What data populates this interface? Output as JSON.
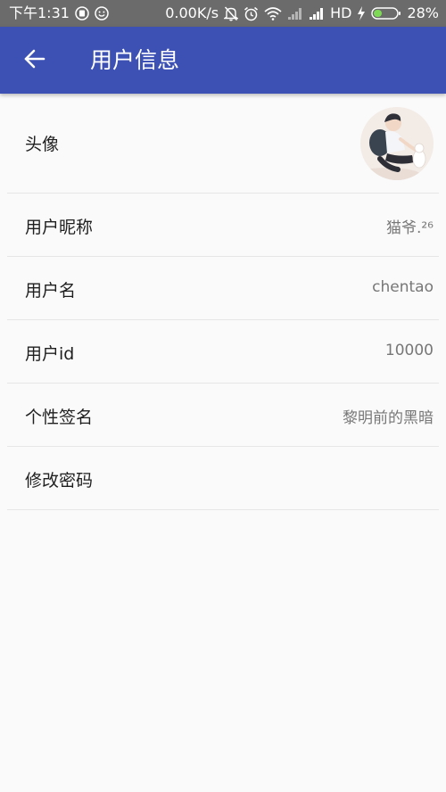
{
  "status_bar": {
    "time": "下午1:31",
    "net_speed": "0.00K/s",
    "hd": "HD",
    "battery": "28%",
    "icons": [
      "app-notification-icon",
      "emoji-notification-icon",
      "mute-icon",
      "alarm-icon",
      "wifi-icon",
      "signal-icon",
      "signal-icon",
      "charging-icon",
      "battery-icon"
    ]
  },
  "app_bar": {
    "title": "用户信息",
    "back_icon": "arrow-left-icon",
    "color": "#3d51b4"
  },
  "profile": {
    "rows": [
      {
        "label": "头像",
        "value": "",
        "type": "avatar"
      },
      {
        "label": "用户昵称",
        "value": "猫爷.²⁶"
      },
      {
        "label": "用户名",
        "value": "chentao"
      },
      {
        "label": "用户id",
        "value": "10000"
      },
      {
        "label": "个性签名",
        "value": "黎明前的黑暗"
      },
      {
        "label": "修改密码",
        "value": ""
      }
    ]
  }
}
